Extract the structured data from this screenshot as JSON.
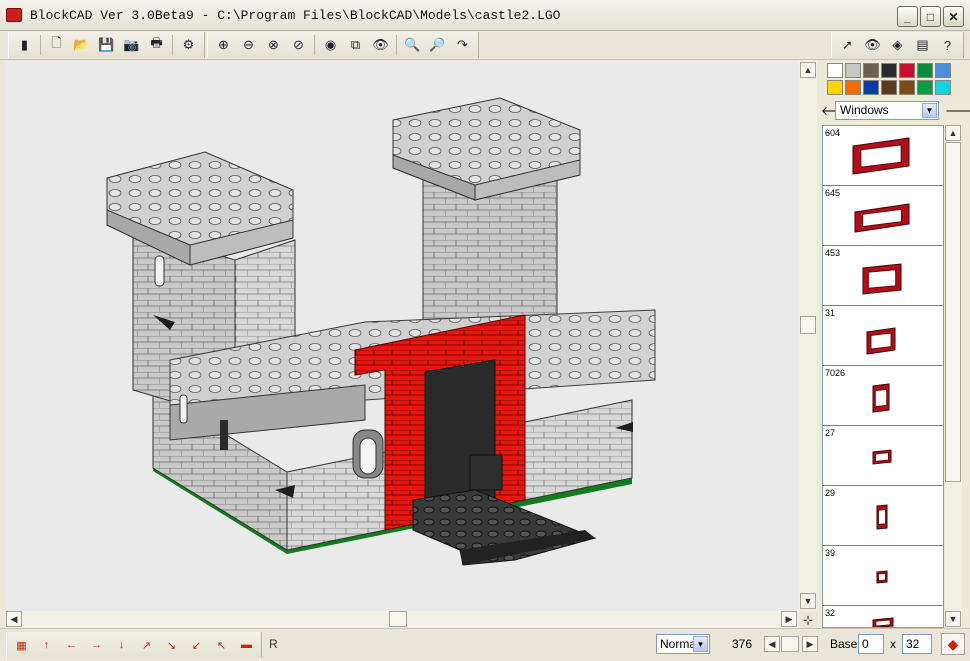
{
  "window": {
    "title": "BlockCAD Ver 3.0Beta9 - C:\\Program Files\\BlockCAD\\Models\\castle2.LGO",
    "minimize_icon": "minimize-icon",
    "maximize_icon": "maximize-icon",
    "close_icon": "close-icon"
  },
  "toolbar": {
    "main_tools": [
      {
        "name": "brick-logo-button",
        "icon": "brick-icon",
        "glyph": "▮"
      },
      {
        "name": "new-button",
        "icon": "new-file-icon",
        "glyph": "🗋"
      },
      {
        "name": "open-button",
        "icon": "folder-open-icon",
        "glyph": "📂"
      },
      {
        "name": "save-button",
        "icon": "floppy-icon",
        "glyph": "💾"
      },
      {
        "name": "camera-button",
        "icon": "camera-icon",
        "glyph": "📷"
      },
      {
        "name": "print-button",
        "icon": "printer-icon",
        "glyph": "🖶"
      },
      {
        "name": "settings-button",
        "icon": "gear-icon",
        "glyph": "⚙"
      }
    ],
    "view_tools": [
      {
        "name": "rotate-x-button",
        "icon": "rotate-x-icon",
        "glyph": "⊕"
      },
      {
        "name": "rotate-y-button",
        "icon": "rotate-y-icon",
        "glyph": "⊖"
      },
      {
        "name": "rotate-z-button",
        "icon": "rotate-z-icon",
        "glyph": "⊗"
      },
      {
        "name": "rotate-free-button",
        "icon": "rotate-free-icon",
        "glyph": "⊘"
      },
      {
        "name": "brick-view-button",
        "icon": "brick-view-icon",
        "glyph": "◉"
      },
      {
        "name": "wireframe-button",
        "icon": "cube-icon",
        "glyph": "⧉"
      },
      {
        "name": "preview-button",
        "icon": "eye-icon",
        "glyph": "👁"
      },
      {
        "name": "zoom-in-button",
        "icon": "zoom-in-icon",
        "glyph": "🔍"
      },
      {
        "name": "zoom-out-button",
        "icon": "zoom-out-icon",
        "glyph": "🔎"
      },
      {
        "name": "pan-button",
        "icon": "pan-icon",
        "glyph": "↷"
      }
    ],
    "panel_tools": [
      {
        "name": "select-button",
        "icon": "pointer-icon",
        "glyph": "➚"
      },
      {
        "name": "panel-view-button",
        "icon": "eye-icon",
        "glyph": "👁"
      },
      {
        "name": "panel-brick-button",
        "icon": "brick-view-icon",
        "glyph": "◈"
      },
      {
        "name": "color-button",
        "icon": "rainbow-icon",
        "glyph": "▤"
      },
      {
        "name": "help-button",
        "icon": "help-icon",
        "glyph": "?"
      }
    ]
  },
  "palette": {
    "colors": [
      "#ffffff",
      "#c7c7c7",
      "#6b5f4e",
      "#2b2b2b",
      "#c4102e",
      "#118a3d",
      "#4a8fd8",
      "#ffd400",
      "#f06d00",
      "#0c3ca3",
      "#5c3a1e",
      "#7b4a1a",
      "#0f9a4a",
      "#14d3e0"
    ]
  },
  "category": {
    "selected": "Windows",
    "prev_icon": "arrow-left-icon",
    "next_icon": "arrow-right-icon"
  },
  "parts": [
    {
      "id": "604"
    },
    {
      "id": "645"
    },
    {
      "id": "453"
    },
    {
      "id": "31"
    },
    {
      "id": "7026"
    },
    {
      "id": "27"
    },
    {
      "id": "29"
    },
    {
      "id": "39"
    },
    {
      "id": "32"
    }
  ],
  "statusbar": {
    "move_tools": [
      {
        "name": "grid-button",
        "icon": "grid-icon",
        "glyph": "▦"
      },
      {
        "name": "move-up-button",
        "icon": "arrow-up-icon",
        "glyph": "↑"
      },
      {
        "name": "move-left-button",
        "icon": "arrow-left-icon",
        "glyph": "←"
      },
      {
        "name": "move-right-button",
        "icon": "arrow-right-icon",
        "glyph": "→"
      },
      {
        "name": "move-down-button",
        "icon": "arrow-down-icon",
        "glyph": "↓"
      },
      {
        "name": "move-ne-button",
        "icon": "arrow-ne-icon",
        "glyph": "↗"
      },
      {
        "name": "move-se-button",
        "icon": "arrow-se-icon",
        "glyph": "↘"
      },
      {
        "name": "move-sw-button",
        "icon": "arrow-sw-icon",
        "glyph": "↙"
      },
      {
        "name": "move-nw-button",
        "icon": "arrow-nw-icon",
        "glyph": "↖"
      },
      {
        "name": "add-brick-button",
        "icon": "brick-icon",
        "glyph": "▬"
      }
    ],
    "rotate_label": "R",
    "mode": "Norma",
    "count": "376",
    "base_label": "Base:",
    "base_value": "0",
    "x_label": "x",
    "size_value": "32",
    "erase_icon": "eraser-icon"
  }
}
